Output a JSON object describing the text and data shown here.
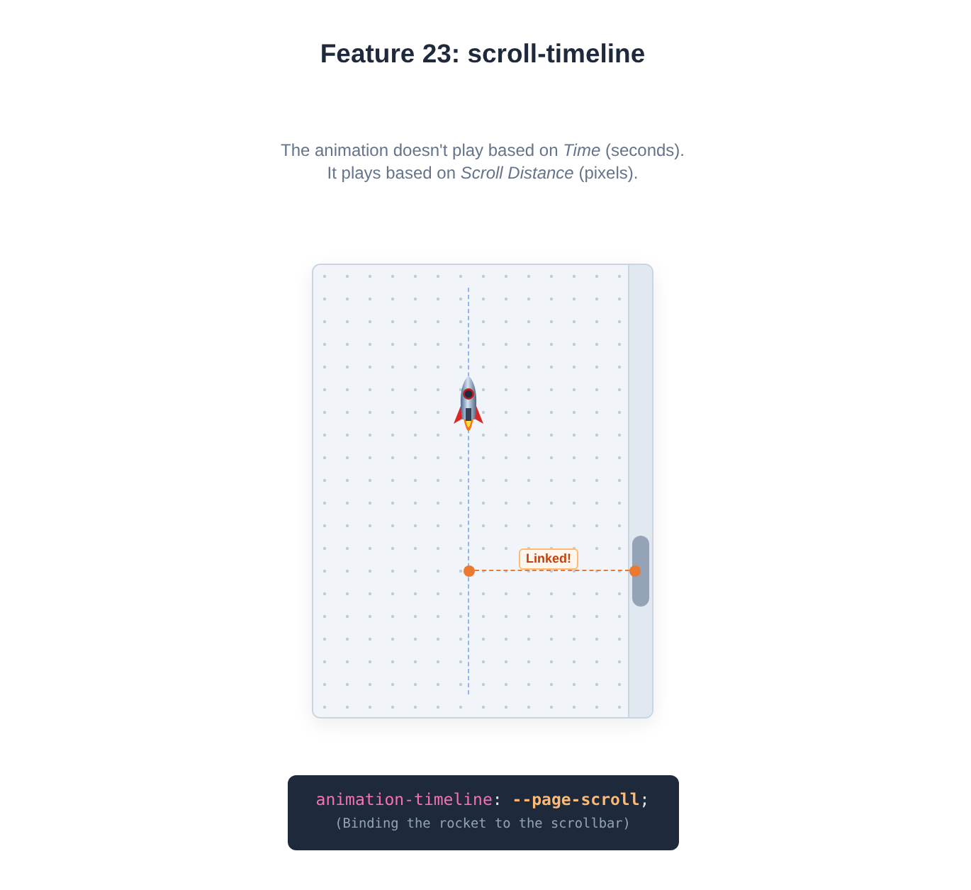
{
  "title": "Feature 23: scroll-timeline",
  "description": [
    "The animation doesn't play based on *Time* (seconds).",
    "It plays based on *Scroll Distance* (pixels)."
  ],
  "demo": {
    "tag": "Linked!"
  },
  "code": {
    "tokens": [
      {
        "text": "animation-timeline",
        "kind": "property"
      },
      {
        "text": ": ",
        "kind": "punctuation"
      },
      {
        "text": "--page-scroll",
        "kind": "value"
      },
      {
        "text": ";",
        "kind": "punctuation"
      }
    ],
    "caption": "(Binding the rocket to the scrollbar)"
  }
}
